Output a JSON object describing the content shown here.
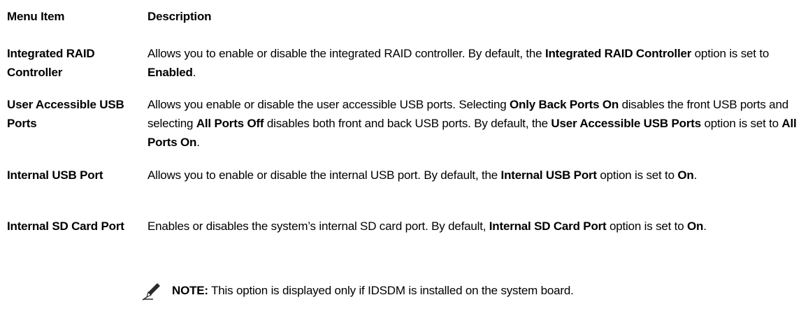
{
  "table": {
    "headers": {
      "menu_item": "Menu Item",
      "description": "Description"
    },
    "rows": [
      {
        "name": "Integrated RAID Controller",
        "desc": [
          {
            "t": "Allows you to enable or disable the integrated RAID controller. By default, the "
          },
          {
            "t": "Integrated RAID Controller",
            "b": true
          },
          {
            "t": " option is set to "
          },
          {
            "t": "Enabled",
            "b": true
          },
          {
            "t": "."
          }
        ]
      },
      {
        "name": "User Accessible USB Ports",
        "desc": [
          {
            "t": "Allows you enable or disable the user accessible USB ports. Selecting "
          },
          {
            "t": "Only Back Ports On",
            "b": true
          },
          {
            "t": " disables the front USB ports and selecting "
          },
          {
            "t": "All Ports Off",
            "b": true
          },
          {
            "t": " disables both front and back USB ports. By default, the "
          },
          {
            "t": "User Accessible USB Ports",
            "b": true
          },
          {
            "t": " option is set to "
          },
          {
            "t": "All Ports On",
            "b": true
          },
          {
            "t": "."
          }
        ]
      },
      {
        "name": "Internal USB Port",
        "desc": [
          {
            "t": "Allows you to enable or disable the internal USB port. By default, the "
          },
          {
            "t": "Internal USB Port",
            "b": true
          },
          {
            "t": " option is set to "
          },
          {
            "t": "On",
            "b": true
          },
          {
            "t": "."
          }
        ]
      },
      {
        "name": "Internal SD Card Port",
        "desc": [
          {
            "t": "Enables or disables the system’s internal SD card port. By default, "
          },
          {
            "t": "Internal SD Card Port",
            "b": true
          },
          {
            "t": " option is set to "
          },
          {
            "t": "On",
            "b": true
          },
          {
            "t": "."
          }
        ]
      }
    ]
  },
  "note": {
    "icon": "pencil-note-icon",
    "label": "NOTE:",
    "text": " This option is displayed only if IDSDM is installed on the system board."
  }
}
